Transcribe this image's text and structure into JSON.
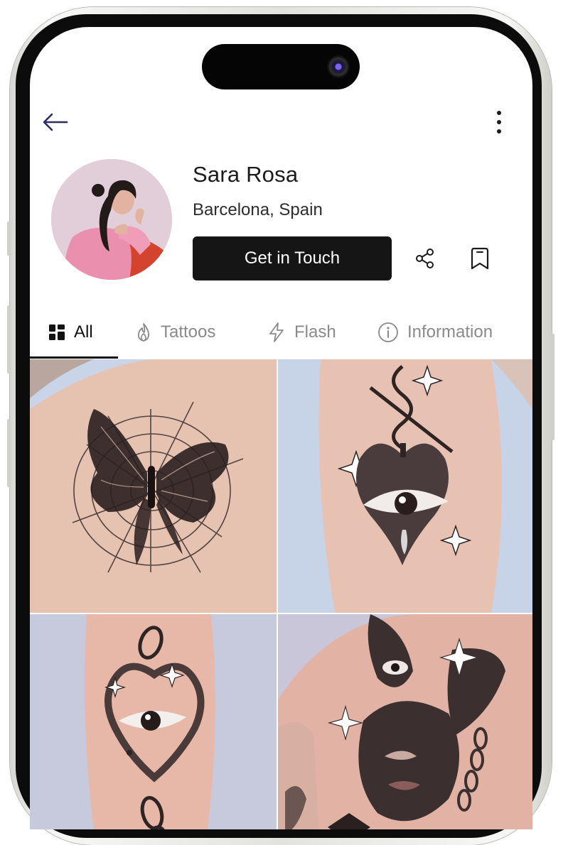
{
  "profile": {
    "name": "Sara Rosa",
    "location": "Barcelona, Spain",
    "cta_label": "Get in Touch"
  },
  "header": {
    "back_icon": "arrow-left-icon",
    "more_icon": "kebab-menu-icon"
  },
  "actions": {
    "share_icon": "share-icon",
    "bookmark_icon": "bookmark-icon"
  },
  "tabs": [
    {
      "label": "All",
      "icon": "grid-icon",
      "active": true
    },
    {
      "label": "Tattoos",
      "icon": "flame-icon",
      "active": false
    },
    {
      "label": "Flash",
      "icon": "lightning-icon",
      "active": false
    },
    {
      "label": "Information",
      "icon": "info-icon",
      "active": false
    }
  ],
  "gallery": [
    {
      "subject": "butterfly-spiderweb-tattoo"
    },
    {
      "subject": "heart-eye-tattoo"
    },
    {
      "subject": "chain-heart-eye-tattoo"
    },
    {
      "subject": "bunny-face-tattoo"
    }
  ],
  "colors": {
    "primary_button": "#151515",
    "text_primary": "#1b1b1b",
    "tab_inactive": "#8a8a8a",
    "back_arrow": "#2c2f5e"
  }
}
